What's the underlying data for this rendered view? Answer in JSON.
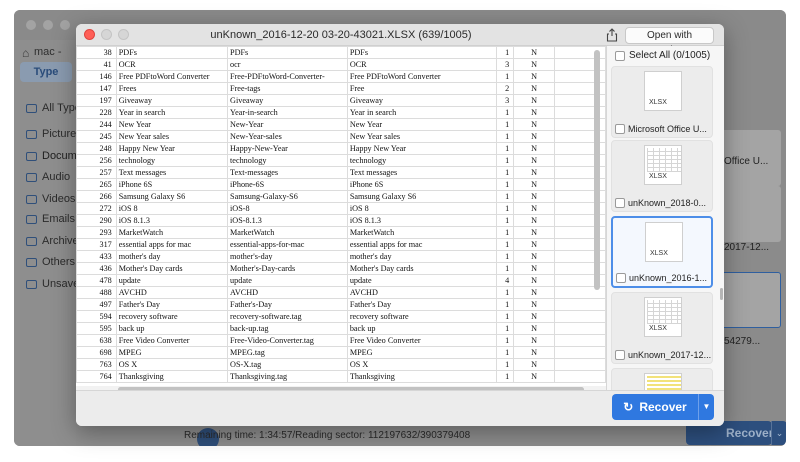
{
  "background_app": {
    "location": "mac -",
    "type_tab": "Type",
    "sidebar": [
      {
        "label": "All Type",
        "icon": "list-icon"
      },
      {
        "label": "Pictures",
        "icon": "picture-icon"
      },
      {
        "label": "Docume",
        "icon": "document-icon",
        "selected": true
      },
      {
        "label": "Audio",
        "icon": "audio-icon"
      },
      {
        "label": "Videos",
        "icon": "video-icon"
      },
      {
        "label": "Emails",
        "icon": "email-icon"
      },
      {
        "label": "Archive",
        "icon": "archive-icon"
      },
      {
        "label": "Others",
        "icon": "other-icon"
      },
      {
        "label": "Unsave",
        "icon": "unsaved-icon"
      }
    ],
    "right_labels": [
      "Office U...",
      "2017-12...",
      "54279..."
    ],
    "status": "Remaining time: 1:34:57/Reading sector: 112197632/390379408",
    "recover_label": "Recover"
  },
  "modal": {
    "title": "unKnown_2016-12-20 03-20-43021.XLSX (639/1005)",
    "open_with": "Open with Numbers",
    "select_all": "Select All (0/1005)",
    "recover_label": "Recover",
    "thumbnails": [
      {
        "label": "Microsoft Office U...",
        "tag": "XLSX",
        "style": "plain",
        "selected": false
      },
      {
        "label": "unKnown_2018-0...",
        "tag": "XLSX",
        "style": "grid",
        "selected": false
      },
      {
        "label": "unKnown_2016-1...",
        "tag": "XLSX",
        "style": "plain",
        "selected": true
      },
      {
        "label": "unKnown_2017-12...",
        "tag": "XLSX",
        "style": "grid",
        "selected": false
      },
      {
        "label": "",
        "tag": "XLSX",
        "style": "yellow",
        "selected": false
      }
    ]
  },
  "sheet_rows": [
    [
      "38",
      "PDFs",
      "PDFs",
      "PDFs",
      "1",
      "N"
    ],
    [
      "41",
      "OCR",
      "ocr",
      "OCR",
      "3",
      "N"
    ],
    [
      "146",
      "Free PDFtoWord Converter",
      "Free-PDFtoWord-Converter-",
      "Free PDFtoWord Converter",
      "1",
      "N"
    ],
    [
      "147",
      "Frees",
      "Free-tags",
      "Free",
      "2",
      "N"
    ],
    [
      "197",
      "Giveaway",
      "Giveaway",
      "Giveaway",
      "3",
      "N"
    ],
    [
      "228",
      "Year in search",
      "Year-in-search",
      "Year in search",
      "1",
      "N"
    ],
    [
      "244",
      "New Year",
      "New-Year",
      "New Year",
      "1",
      "N"
    ],
    [
      "245",
      "New Year sales",
      "New-Year-sales",
      "New Year sales",
      "1",
      "N"
    ],
    [
      "248",
      "Happy New Year",
      "Happy-New-Year",
      "Happy New Year",
      "1",
      "N"
    ],
    [
      "256",
      "technology",
      "technology",
      "technology",
      "1",
      "N"
    ],
    [
      "257",
      "Text messages",
      "Text-messages",
      "Text messages",
      "1",
      "N"
    ],
    [
      "265",
      "iPhone 6S",
      "iPhone-6S",
      "iPhone 6S",
      "1",
      "N"
    ],
    [
      "266",
      "Samsung Galaxy S6",
      "Samsung-Galaxy-S6",
      "Samsung Galaxy S6",
      "1",
      "N"
    ],
    [
      "272",
      "iOS 8",
      "iOS-8",
      "iOS 8",
      "1",
      "N"
    ],
    [
      "290",
      "iOS 8.1.3",
      "iOS-8.1.3",
      "iOS 8.1.3",
      "1",
      "N"
    ],
    [
      "293",
      "MarketWatch",
      "MarketWatch",
      "MarketWatch",
      "1",
      "N"
    ],
    [
      "317",
      "essential apps for mac",
      "essential-apps-for-mac",
      "essential apps for mac",
      "1",
      "N"
    ],
    [
      "433",
      "mother's day",
      "mother's-day",
      "mother's day",
      "1",
      "N"
    ],
    [
      "436",
      "Mother's Day cards",
      "Mother's-Day-cards",
      "Mother's Day cards",
      "1",
      "N"
    ],
    [
      "478",
      "update",
      "update",
      "update",
      "4",
      "N"
    ],
    [
      "488",
      "AVCHD",
      "AVCHD",
      "AVCHD",
      "1",
      "N"
    ],
    [
      "497",
      "Father's Day",
      "Father's-Day",
      "Father's Day",
      "1",
      "N"
    ],
    [
      "594",
      "recovery software",
      "recovery-software.tag",
      "recovery software",
      "1",
      "N"
    ],
    [
      "595",
      "back up",
      "back-up.tag",
      "back up",
      "1",
      "N"
    ],
    [
      "638",
      "Free Video Converter",
      "Free-Video-Converter.tag",
      "Free Video Converter",
      "1",
      "N"
    ],
    [
      "698",
      "MPEG",
      "MPEG.tag",
      "MPEG",
      "1",
      "N"
    ],
    [
      "763",
      "OS X",
      "OS-X.tag",
      "OS X",
      "1",
      "N"
    ],
    [
      "764",
      "Thanksgiving",
      "Thanksgiving.tag",
      "Thanksgiving",
      "1",
      "N"
    ]
  ],
  "colors": {
    "accent": "#2f78e0",
    "close": "#ff5f57"
  }
}
